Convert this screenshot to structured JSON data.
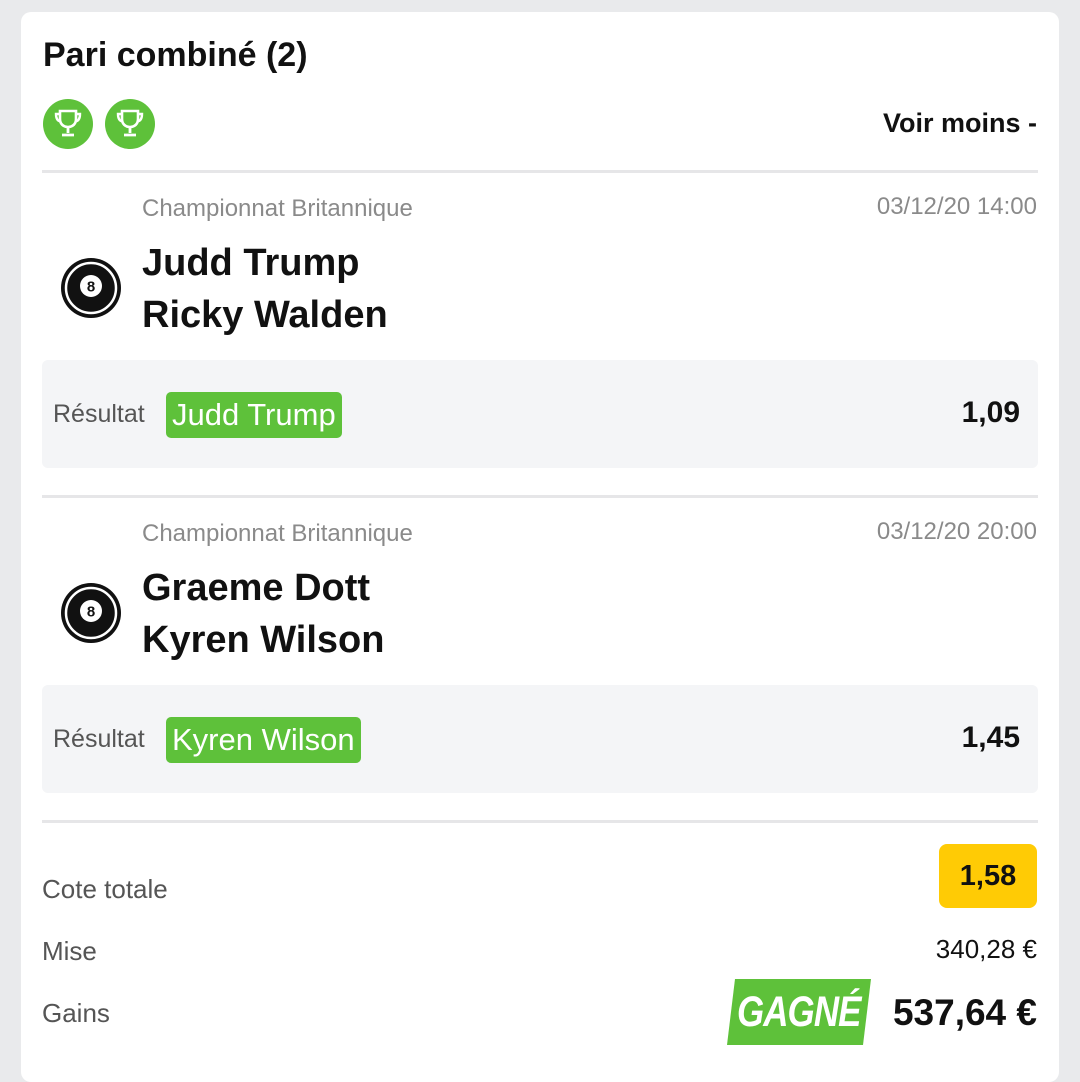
{
  "header": {
    "title": "Pari combiné (2)",
    "toggle_label": "Voir moins -"
  },
  "trophies": [
    "trophy-icon",
    "trophy-icon"
  ],
  "matches": [
    {
      "competition": "Championnat Britannique",
      "datetime": "03/12/20 14:00",
      "sport_icon": "billiard-ball-8-icon",
      "team1": "Judd Trump",
      "team2": "Ricky Walden",
      "result_label": "Résultat",
      "pick": "Judd Trump",
      "odd": "1,09"
    },
    {
      "competition": "Championnat Britannique",
      "datetime": "03/12/20 20:00",
      "sport_icon": "billiard-ball-8-icon",
      "team1": "Graeme Dott",
      "team2": "Kyren Wilson",
      "result_label": "Résultat",
      "pick": "Kyren Wilson",
      "odd": "1,45"
    }
  ],
  "summary": {
    "cote_label": "Cote totale",
    "cote_value": "1,58",
    "mise_label": "Mise",
    "mise_value": "340,28 €",
    "gains_label": "Gains",
    "status_badge": "GAGNÉ",
    "gains_value": "537,64 €"
  },
  "colors": {
    "accent_green": "#5ec13a",
    "odds_yellow": "#ffcb05"
  }
}
